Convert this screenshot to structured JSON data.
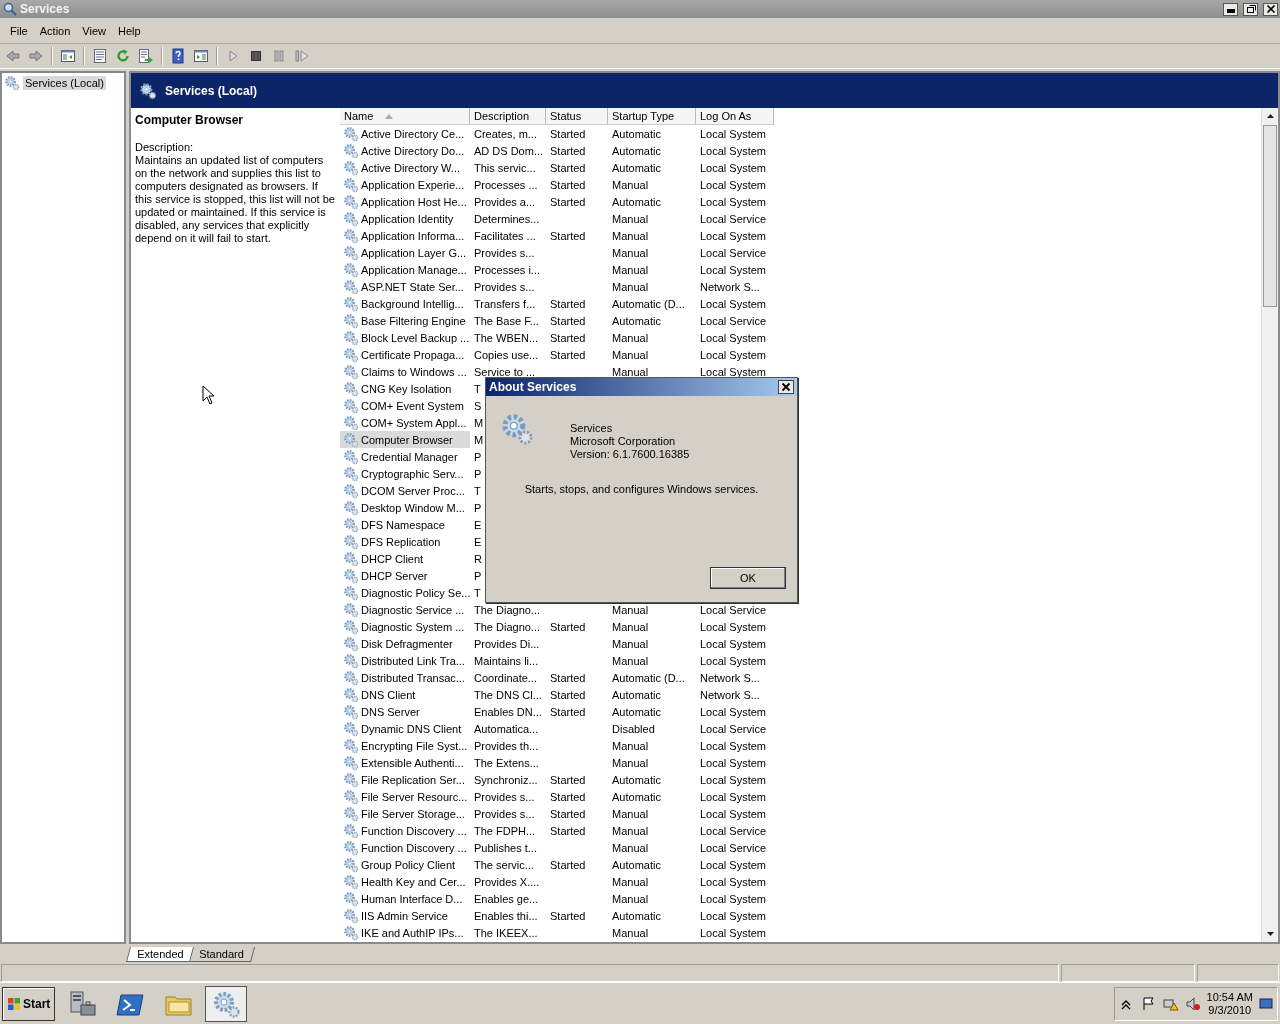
{
  "window": {
    "title": "Services"
  },
  "menu": [
    "File",
    "Action",
    "View",
    "Help"
  ],
  "toolbar": [
    {
      "kind": "back"
    },
    {
      "kind": "forward"
    },
    {
      "kind": "console-tree"
    },
    {
      "kind": "properties"
    },
    {
      "kind": "refresh"
    },
    {
      "kind": "export"
    },
    {
      "kind": "help"
    },
    {
      "kind": "action-pane"
    },
    {
      "kind": "start"
    },
    {
      "kind": "stop"
    },
    {
      "kind": "pause"
    },
    {
      "kind": "resume"
    }
  ],
  "tree": [
    {
      "label": "Services (Local)",
      "selected": true
    }
  ],
  "panel_title": "Services (Local)",
  "details": {
    "service_name": "Computer Browser",
    "description_label": "Description:",
    "description": "Maintains an updated list of computers on the network and supplies this list to computers designated as browsers. If this service is stopped, this list will not be updated or maintained. If this service is disabled, any services that explicitly depend on it will fail to start."
  },
  "table": {
    "columns": [
      {
        "label": "Name",
        "sorted": true
      },
      {
        "label": "Description",
        "sorted": false
      },
      {
        "label": "Status",
        "sorted": false
      },
      {
        "label": "Startup Type",
        "sorted": false
      },
      {
        "label": "Log On As",
        "sorted": false
      }
    ],
    "rows": [
      {
        "name": "Active Directory Ce...",
        "description": "Creates, m...",
        "status": "Started",
        "startup_type": "Automatic",
        "log_on_as": "Local System",
        "selected": false
      },
      {
        "name": "Active Directory Do...",
        "description": "AD DS Dom...",
        "status": "Started",
        "startup_type": "Automatic",
        "log_on_as": "Local System",
        "selected": false
      },
      {
        "name": "Active Directory W...",
        "description": "This servic...",
        "status": "Started",
        "startup_type": "Automatic",
        "log_on_as": "Local System",
        "selected": false
      },
      {
        "name": "Application Experie...",
        "description": "Processes ...",
        "status": "Started",
        "startup_type": "Manual",
        "log_on_as": "Local System",
        "selected": false
      },
      {
        "name": "Application Host He...",
        "description": "Provides a...",
        "status": "Started",
        "startup_type": "Automatic",
        "log_on_as": "Local System",
        "selected": false
      },
      {
        "name": "Application Identity",
        "description": "Determines...",
        "startup_type": "Manual",
        "log_on_as": "Local Service",
        "selected": false
      },
      {
        "name": "Application Informa...",
        "description": "Facilitates ...",
        "status": "Started",
        "startup_type": "Manual",
        "log_on_as": "Local System",
        "selected": false
      },
      {
        "name": "Application Layer G...",
        "description": "Provides s...",
        "startup_type": "Manual",
        "log_on_as": "Local Service",
        "selected": false
      },
      {
        "name": "Application Manage...",
        "description": "Processes i...",
        "startup_type": "Manual",
        "log_on_as": "Local System",
        "selected": false
      },
      {
        "name": "ASP.NET State Ser...",
        "description": "Provides s...",
        "startup_type": "Manual",
        "log_on_as": "Network S...",
        "selected": false
      },
      {
        "name": "Background Intellig...",
        "description": "Transfers f...",
        "status": "Started",
        "startup_type": "Automatic (D...",
        "log_on_as": "Local System",
        "selected": false
      },
      {
        "name": "Base Filtering Engine",
        "description": "The Base F...",
        "status": "Started",
        "startup_type": "Automatic",
        "log_on_as": "Local Service",
        "selected": false
      },
      {
        "name": "Block Level Backup ...",
        "description": "The WBEN...",
        "status": "Started",
        "startup_type": "Manual",
        "log_on_as": "Local System",
        "selected": false
      },
      {
        "name": "Certificate Propaga...",
        "description": "Copies use...",
        "status": "Started",
        "startup_type": "Manual",
        "log_on_as": "Local System",
        "selected": false
      },
      {
        "name": "Claims to Windows ...",
        "description": "Service to ...",
        "startup_type": "Manual",
        "log_on_as": "Local System",
        "selected": false
      },
      {
        "name": "CNG Key Isolation",
        "description": "T",
        "selected": false
      },
      {
        "name": "COM+ Event System",
        "description": "S",
        "selected": false
      },
      {
        "name": "COM+ System Appl...",
        "description": "M",
        "selected": false
      },
      {
        "name": "Computer Browser",
        "description": "M",
        "selected": true
      },
      {
        "name": "Credential Manager",
        "description": "P",
        "selected": false
      },
      {
        "name": "Cryptographic Serv...",
        "description": "P",
        "selected": false
      },
      {
        "name": "DCOM Server Proc...",
        "description": "T",
        "selected": false
      },
      {
        "name": "Desktop Window M...",
        "description": "P",
        "selected": false
      },
      {
        "name": "DFS Namespace",
        "description": "E",
        "selected": false
      },
      {
        "name": "DFS Replication",
        "description": "E",
        "selected": false
      },
      {
        "name": "DHCP Client",
        "description": "R",
        "selected": false
      },
      {
        "name": "DHCP Server",
        "description": "P",
        "selected": false
      },
      {
        "name": "Diagnostic Policy Se...",
        "description": "T",
        "selected": false
      },
      {
        "name": "Diagnostic Service ...",
        "description": "The Diagno...",
        "startup_type": "Manual",
        "log_on_as": "Local Service",
        "selected": false
      },
      {
        "name": "Diagnostic System ...",
        "description": "The Diagno...",
        "status": "Started",
        "startup_type": "Manual",
        "log_on_as": "Local System",
        "selected": false
      },
      {
        "name": "Disk Defragmenter",
        "description": "Provides Di...",
        "startup_type": "Manual",
        "log_on_as": "Local System",
        "selected": false
      },
      {
        "name": "Distributed Link Tra...",
        "description": "Maintains li...",
        "startup_type": "Manual",
        "log_on_as": "Local System",
        "selected": false
      },
      {
        "name": "Distributed Transac...",
        "description": "Coordinate...",
        "status": "Started",
        "startup_type": "Automatic (D...",
        "log_on_as": "Network S...",
        "selected": false
      },
      {
        "name": "DNS Client",
        "description": "The DNS Cl...",
        "status": "Started",
        "startup_type": "Automatic",
        "log_on_as": "Network S...",
        "selected": false
      },
      {
        "name": "DNS Server",
        "description": "Enables DN...",
        "status": "Started",
        "startup_type": "Automatic",
        "log_on_as": "Local System",
        "selected": false
      },
      {
        "name": "Dynamic DNS Client",
        "description": "Automatica...",
        "startup_type": "Disabled",
        "log_on_as": "Local Service",
        "selected": false
      },
      {
        "name": "Encrypting File Syst...",
        "description": "Provides th...",
        "startup_type": "Manual",
        "log_on_as": "Local System",
        "selected": false
      },
      {
        "name": "Extensible Authenti...",
        "description": "The Extens...",
        "startup_type": "Manual",
        "log_on_as": "Local System",
        "selected": false
      },
      {
        "name": "File Replication Ser...",
        "description": "Synchroniz...",
        "status": "Started",
        "startup_type": "Automatic",
        "log_on_as": "Local System",
        "selected": false
      },
      {
        "name": "File Server Resourc...",
        "description": "Provides s...",
        "status": "Started",
        "startup_type": "Automatic",
        "log_on_as": "Local System",
        "selected": false
      },
      {
        "name": "File Server Storage...",
        "description": "Provides s...",
        "status": "Started",
        "startup_type": "Manual",
        "log_on_as": "Local System",
        "selected": false
      },
      {
        "name": "Function Discovery ...",
        "description": "The FDPH...",
        "status": "Started",
        "startup_type": "Manual",
        "log_on_as": "Local Service",
        "selected": false
      },
      {
        "name": "Function Discovery ...",
        "description": "Publishes t...",
        "startup_type": "Manual",
        "log_on_as": "Local Service",
        "selected": false
      },
      {
        "name": "Group Policy Client",
        "description": "The servic...",
        "status": "Started",
        "startup_type": "Automatic",
        "log_on_as": "Local System",
        "selected": false
      },
      {
        "name": "Health Key and Cer...",
        "description": "Provides X....",
        "startup_type": "Manual",
        "log_on_as": "Local System",
        "selected": false
      },
      {
        "name": "Human Interface D...",
        "description": "Enables ge...",
        "startup_type": "Manual",
        "log_on_as": "Local System",
        "selected": false
      },
      {
        "name": "IIS Admin Service",
        "description": "Enables thi...",
        "status": "Started",
        "startup_type": "Automatic",
        "log_on_as": "Local System",
        "selected": false
      },
      {
        "name": "IKE and AuthIP IPs...",
        "description": "The IKEEX...",
        "startup_type": "Manual",
        "log_on_as": "Local System",
        "selected": false
      }
    ]
  },
  "view_tabs": [
    {
      "label": "Extended",
      "selected": true
    },
    {
      "label": "Standard",
      "selected": false
    }
  ],
  "dialog": {
    "title": "About Services",
    "lines": [
      "Services",
      "Microsoft Corporation",
      "Version: 6.1.7600.16385"
    ],
    "summary": "Starts, stops, and configures Windows services.",
    "button": "OK"
  },
  "taskbar": {
    "start": "Start",
    "apps": [
      {
        "kind": "server-manager",
        "active": false
      },
      {
        "kind": "powershell",
        "active": false
      },
      {
        "kind": "explorer",
        "active": false
      },
      {
        "kind": "services",
        "active": true
      }
    ],
    "time": "10:54 AM",
    "date": "9/3/2010"
  }
}
